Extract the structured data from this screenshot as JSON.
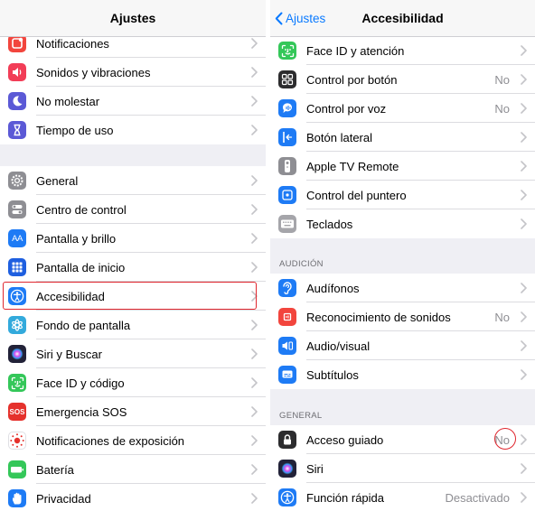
{
  "left": {
    "title": "Ajustes",
    "groups": [
      [
        {
          "label": "Notificaciones",
          "icon": "notifications-icon",
          "color": "#f2453d"
        },
        {
          "label": "Sonidos y vibraciones",
          "icon": "sounds-icon",
          "color": "#f23d57"
        },
        {
          "label": "No molestar",
          "icon": "moon-icon",
          "color": "#5b59d6"
        },
        {
          "label": "Tiempo de uso",
          "icon": "hourglass-icon",
          "color": "#5b59d6"
        }
      ],
      [
        {
          "label": "General",
          "icon": "gear-icon",
          "color": "#8e8e93"
        },
        {
          "label": "Centro de control",
          "icon": "toggles-icon",
          "color": "#8e8e93"
        },
        {
          "label": "Pantalla y brillo",
          "icon": "text-size-icon",
          "color": "#1e7bf5"
        },
        {
          "label": "Pantalla de inicio",
          "icon": "home-grid-icon",
          "color": "#1e5fe0"
        },
        {
          "label": "Accesibilidad",
          "icon": "accessibility-icon",
          "color": "#1e7bf5"
        },
        {
          "label": "Fondo de pantalla",
          "icon": "wallpaper-icon",
          "color": "#33aadc"
        },
        {
          "label": "Siri y Buscar",
          "icon": "siri-icon",
          "color": "#222238"
        },
        {
          "label": "Face ID y código",
          "icon": "face-id-icon",
          "color": "#34c759"
        },
        {
          "label": "Emergencia SOS",
          "icon": "sos-icon",
          "color": "#e5312c"
        },
        {
          "label": "Notificaciones de exposición",
          "icon": "exposure-icon",
          "color": "#ffffff"
        },
        {
          "label": "Batería",
          "icon": "battery-icon",
          "color": "#34c759"
        },
        {
          "label": "Privacidad",
          "icon": "hand-icon",
          "color": "#1e7bf5"
        }
      ]
    ],
    "sos_text": "SOS",
    "text_size_glyph": "AA"
  },
  "right": {
    "back_label": "Ajustes",
    "title": "Accesibilidad",
    "groups": [
      [
        {
          "label": "Face ID y atención",
          "value": "",
          "icon": "face-id-icon",
          "color": "#34c759"
        },
        {
          "label": "Control por botón",
          "value": "No",
          "icon": "switch-control-icon",
          "color": "#2c2c2e"
        },
        {
          "label": "Control por voz",
          "value": "No",
          "icon": "voice-control-icon",
          "color": "#1e7bf5"
        },
        {
          "label": "Botón lateral",
          "value": "",
          "icon": "side-button-icon",
          "color": "#1e7bf5"
        },
        {
          "label": "Apple TV Remote",
          "value": "",
          "icon": "remote-icon",
          "color": "#8e8e93"
        },
        {
          "label": "Control del puntero",
          "value": "",
          "icon": "pointer-icon",
          "color": "#1e7bf5"
        },
        {
          "label": "Teclados",
          "value": "",
          "icon": "keyboard-icon",
          "color": "#a5a5aa"
        }
      ],
      [
        {
          "label": "Audífonos",
          "value": "",
          "icon": "ear-icon",
          "color": "#1e7bf5"
        },
        {
          "label": "Reconocimiento de sonidos",
          "value": "No",
          "icon": "sound-recognition-icon",
          "color": "#f2453d"
        },
        {
          "label": "Audio/visual",
          "value": "",
          "icon": "audio-visual-icon",
          "color": "#1e7bf5"
        },
        {
          "label": "Subtítulos",
          "value": "",
          "icon": "subtitles-icon",
          "color": "#1e7bf5"
        }
      ],
      [
        {
          "label": "Acceso guiado",
          "value": "No",
          "icon": "lock-icon",
          "color": "#2c2c2e"
        },
        {
          "label": "Siri",
          "value": "",
          "icon": "siri-icon",
          "color": "#222238"
        },
        {
          "label": "Función rápida",
          "value": "Desactivado",
          "icon": "accessibility-icon",
          "color": "#1e7bf5"
        }
      ]
    ],
    "section_headers": [
      "AUDICIÓN",
      "GENERAL"
    ]
  }
}
